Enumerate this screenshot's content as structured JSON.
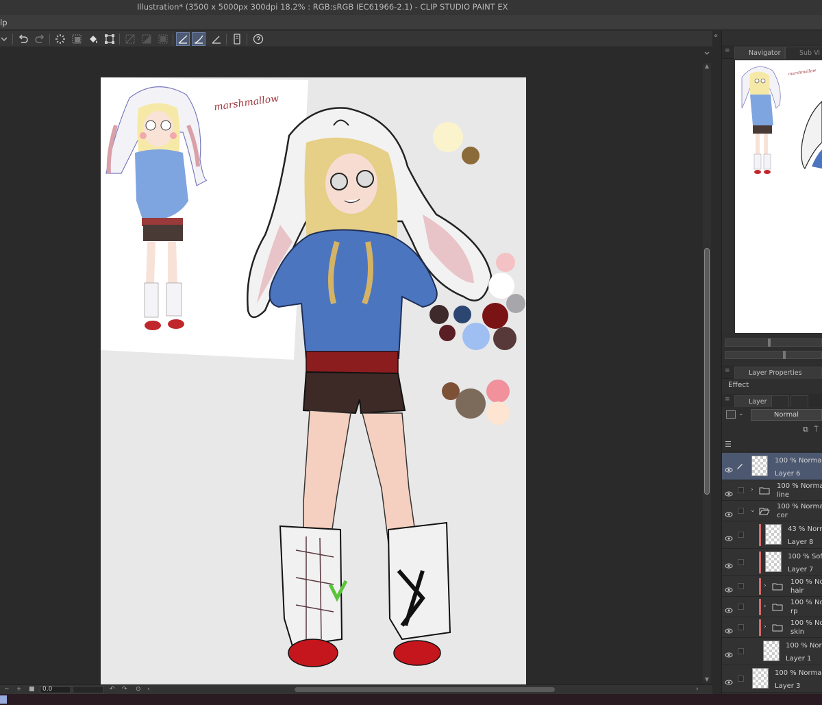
{
  "window": {
    "title": "Illustration* (3500 x 5000px 300dpi 18.2% : RGB:sRGB IEC61966-2.1)  - CLIP STUDIO PAINT EX"
  },
  "menubar": {
    "visible_item": "lp"
  },
  "commandbar": {
    "buttons": [
      {
        "name": "dropdown",
        "icon": "chevron-down-icon"
      },
      {
        "name": "undo",
        "icon": "undo-icon"
      },
      {
        "name": "redo",
        "icon": "redo-icon"
      },
      {
        "name": "clear",
        "icon": "spinner-icon"
      },
      {
        "name": "clear-outside",
        "icon": "clear-outside-icon"
      },
      {
        "name": "fill",
        "icon": "fill-icon"
      },
      {
        "name": "transform",
        "icon": "transform-icon"
      },
      {
        "name": "hide-selection",
        "icon": "deselect-icon"
      },
      {
        "name": "invert-selection",
        "icon": "invert-icon"
      },
      {
        "name": "select-all",
        "icon": "select-all-icon"
      },
      {
        "name": "ruler-snap",
        "icon": "snap-ruler-icon",
        "active": true
      },
      {
        "name": "special-ruler-snap",
        "icon": "snap-special-icon",
        "active": true
      },
      {
        "name": "grid-snap",
        "icon": "snap-grid-icon"
      },
      {
        "name": "device",
        "icon": "device-icon"
      },
      {
        "name": "help",
        "icon": "help-icon"
      }
    ]
  },
  "navigator": {
    "tabs": [
      {
        "label": "Navigator",
        "icon": "navigator-icon"
      },
      {
        "label": "Sub Vi",
        "icon": "sub-view-icon"
      }
    ]
  },
  "layer_properties": {
    "tab_label": "Layer Properties",
    "effect_label": "Effect"
  },
  "layer_panel": {
    "tabs": [
      {
        "label": "Layer",
        "icon": "layers-icon"
      }
    ],
    "blend_mode": "Normal",
    "layers": [
      {
        "mode": "100 % Normal",
        "name": "Layer 6",
        "type": "raster",
        "selected": true
      },
      {
        "mode": "100 % Normal",
        "name": "line",
        "type": "folder",
        "expanded": false
      },
      {
        "mode": "100 % Normal",
        "name": "cor",
        "type": "folder",
        "expanded": true
      },
      {
        "mode": "43 % Norma",
        "name": "Layer 8",
        "type": "raster",
        "clipped": true
      },
      {
        "mode": "100 % Soft",
        "name": "Layer 7",
        "type": "raster",
        "clipped": true
      },
      {
        "mode": "100 % Nor",
        "name": "hair",
        "type": "folder",
        "clipped": true
      },
      {
        "mode": "100 % Nor",
        "name": "rp",
        "type": "folder",
        "clipped": true
      },
      {
        "mode": "100 % Nor",
        "name": "skin",
        "type": "folder",
        "clipped": true
      },
      {
        "mode": "100 % Normal",
        "name": "Layer 1",
        "type": "raster"
      },
      {
        "mode": "100 % Normal",
        "name": "Layer 3",
        "type": "raster"
      }
    ]
  },
  "statusbar": {
    "zoom_value": "0.0",
    "minus": "−",
    "plus": "+"
  },
  "artwork": {
    "sketch_caption": "marshmallow"
  },
  "colors": {
    "accent_selected": "#4b5870",
    "clip_indicator": "#d86a6a"
  }
}
